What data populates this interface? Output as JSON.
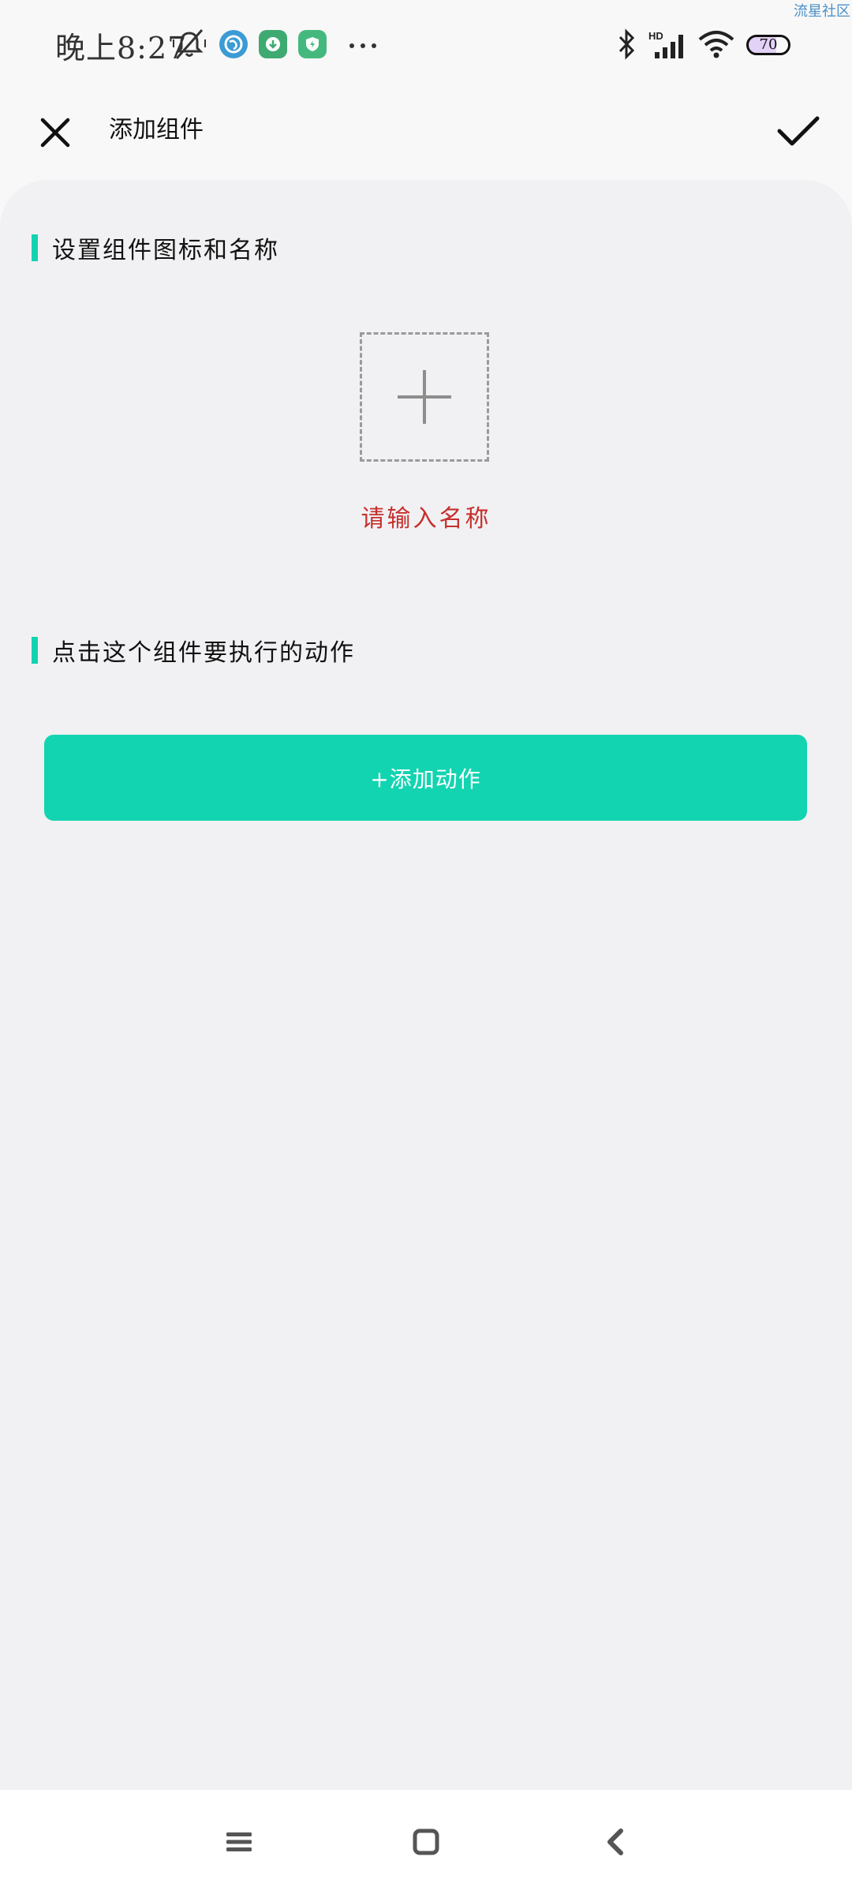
{
  "status_bar": {
    "time": "晚上8:27",
    "battery_level": "70",
    "watermark": "流星社区",
    "icons": [
      "mute-bell-icon",
      "browser-app-icon",
      "download-app-icon",
      "security-app-icon",
      "more-dots-icon",
      "bluetooth-icon",
      "hd-signal-icon",
      "wifi-icon",
      "battery-icon"
    ]
  },
  "header": {
    "title": "添加组件",
    "close_icon": "close-icon",
    "confirm_icon": "check-icon"
  },
  "sections": {
    "icon_name": {
      "heading": "设置组件图标和名称",
      "picker_icon": "plus-icon",
      "name_placeholder": "请输入名称"
    },
    "action": {
      "heading": "点击这个组件要执行的动作",
      "add_button_label": "+添加动作"
    }
  },
  "nav_bar": {
    "icons": [
      "menu-icon",
      "home-icon",
      "back-icon"
    ]
  },
  "colors": {
    "accent": "#14d3b1",
    "placeholder": "#c6302d",
    "panel_bg": "#f1f1f3",
    "page_bg": "#f8f8f8"
  }
}
